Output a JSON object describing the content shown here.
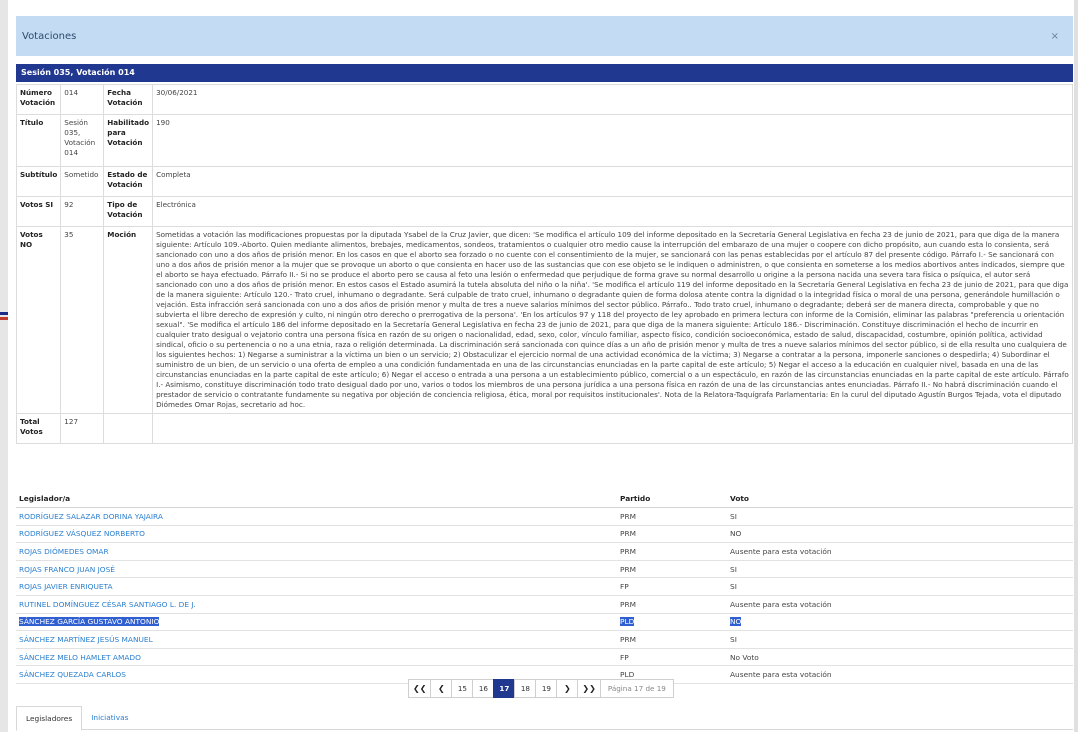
{
  "modal": {
    "title": "Votaciones",
    "close": "×"
  },
  "session_title": "Sesión 035, Votación 014",
  "details": {
    "numero_label": "Número Votación",
    "numero": "014",
    "fecha_label": "Fecha Votación",
    "fecha": "30/06/2021",
    "titulo_label": "Título",
    "titulo": "Sesión 035, Votación 014",
    "habilitado_label": "Habilitado para Votación",
    "habilitado": "190",
    "subtitulo_label": "Subtítulo",
    "subtitulo": "Sometido",
    "estado_label": "Estado de Votación",
    "estado": "Completa",
    "votos_si_label": "Votos SI",
    "votos_si": "92",
    "tipo_label": "Tipo de Votación",
    "tipo": "Electrónica",
    "votos_no_label": "Votos NO",
    "votos_no": "35",
    "mocion_label": "Moción",
    "mocion": "Sometidas a votación las modificaciones propuestas por la diputada Ysabel de la Cruz Javier, que dicen: 'Se modifica el artículo 109 del informe depositado en la Secretaría General Legislativa en fecha 23 de junio de 2021, para que diga de la manera siguiente: Artículo 109.-Aborto. Quien mediante alimentos, brebajes, medicamentos, sondeos, tratamientos o cualquier otro medio cause la interrupción del embarazo de una mujer o coopere con dicho propósito, aun cuando esta lo consienta, será sancionado con uno a dos años de prisión menor. En los casos en que el aborto sea forzado o no cuente con el consentimiento de la mujer, se sancionará con las penas establecidas por el artículo 87 del presente código. Párrafo I.- Se sancionará con uno a dos años de prisión menor a la mujer que se provoque un aborto o que consienta en hacer uso de las sustancias que con ese objeto se le indiquen o administren, o que consienta en someterse a los medios abortivos antes indicados, siempre que el aborto se haya efectuado. Párrafo II.- Si no se produce el aborto pero se causa al feto una lesión o enfermedad que perjudique de forma grave su normal desarrollo u origine a la persona nacida una severa tara física o psíquica, el autor será sancionado con uno a dos años de prisión menor. En estos casos el Estado asumirá la tutela absoluta del niño o la niña'. 'Se modifica el artículo 119 del informe depositado en la Secretaría General Legislativa en fecha 23 de junio de 2021, para que diga de la manera siguiente: Artículo 120.- Trato cruel, inhumano o degradante. Será culpable de trato cruel, inhumano o degradante quien de forma dolosa atente contra la dignidad o la integridad física o moral de una persona, generándole humillación o vejación. Esta infracción será sancionada con uno a dos años de prisión menor y multa de tres a nueve salarios mínimos del sector público. Párrafo.. Todo trato cruel, inhumano o degradante; deberá ser de manera directa, comprobable y que no subvierta el libre derecho de expresión y culto, ni ningún otro derecho o prerrogativa de la persona'. 'En los artículos 97 y 118 del proyecto de ley aprobado en primera lectura con informe de la Comisión, eliminar las palabras \"preferencia u orientación sexual\". 'Se modifica el artículo 186 del informe depositado en la Secretaría General Legislativa en fecha 23 de junio de 2021, para que diga de la manera siguiente: Artículo 186.- Discriminación. Constituye discriminación el hecho de incurrir en cualquier trato desigual o vejatorio contra una persona física en razón de su origen o nacionalidad, edad, sexo, color, vínculo familiar, aspecto físico, condición socioeconómica, estado de salud, discapacidad, costumbre, opinión política, actividad sindical, oficio o su pertenencia o no a una etnia, raza o religión determinada. La discriminación será sancionada con quince días a un año de prisión menor y multa de tres a nueve salarios mínimos del sector público, si de ella resulta uno cualquiera de los siguientes hechos: 1) Negarse a suministrar a la víctima un bien o un servicio; 2) Obstaculizar el ejercicio normal de una actividad económica de la víctima; 3) Negarse a contratar a la persona, imponerle sanciones o despedirla; 4) Subordinar el suministro de un bien, de un servicio o una oferta de empleo a una condición fundamentada en una de las circunstancias enunciadas en la parte capital de este artículo; 5) Negar el acceso a la educación en cualquier nivel, basada en una de las circunstancias enunciadas en la parte capital de este artículo; 6) Negar el acceso o entrada a una persona a un establecimiento público, comercial o a un espectáculo, en razón de las circunstancias enunciadas en la parte capital de este artículo. Párrafo I.- Asimismo, constituye discriminación todo trato desigual dado por uno, varios o todos los miembros de una persona jurídica a una persona física en razón de una de las circunstancias antes enunciadas. Párrafo II.- No habrá discriminación cuando el prestador de servicio o contratante fundamente su negativa por objeción de conciencia religiosa, ética, moral por requisitos institucionales'. Nota de la Relatora-Taquígrafa Parlamentaria: En la curul del diputado Agustín Burgos Tejada, vota el diputado Diómedes Omar Rojas, secretario ad hoc.",
    "total_label": "Total Votos",
    "total": "127"
  },
  "list": {
    "headers": {
      "legislador": "Legislador/a",
      "partido": "Partido",
      "voto": "Voto"
    },
    "rows": [
      {
        "name": "RODRÍGUEZ SALAZAR DORINA YAJAIRA",
        "party": "PRM",
        "vote": "SI"
      },
      {
        "name": "RODRÍGUEZ VÁSQUEZ NORBERTO",
        "party": "PRM",
        "vote": "NO"
      },
      {
        "name": "ROJAS DIÓMEDES OMAR",
        "party": "PRM",
        "vote": "Ausente para esta votación"
      },
      {
        "name": "ROJAS FRANCO JUAN JOSÉ",
        "party": "PRM",
        "vote": "SI"
      },
      {
        "name": "ROJAS JAVIER ENRIQUETA",
        "party": "FP",
        "vote": "SI"
      },
      {
        "name": "RUTINEL DOMÍNGUEZ CÉSAR SANTIAGO L. DE J.",
        "party": "PRM",
        "vote": "Ausente para esta votación"
      },
      {
        "name": "SÁNCHEZ GARCÍA GUSTAVO ANTONIO",
        "party": "PLD",
        "vote": "NO"
      },
      {
        "name": "SÁNCHEZ MARTÍNEZ JESÚS MANUEL",
        "party": "PRM",
        "vote": "SI"
      },
      {
        "name": "SÁNCHEZ MELO HAMLET AMADO",
        "party": "FP",
        "vote": "No Voto"
      },
      {
        "name": "SÁNCHEZ QUEZADA CARLOS",
        "party": "PLD",
        "vote": "Ausente para esta votación"
      }
    ],
    "selected_row": 6
  },
  "pagination": {
    "first": "❮❮",
    "prev": "❮",
    "pages": [
      "15",
      "16",
      "17",
      "18",
      "19"
    ],
    "current": "17",
    "next": "❯",
    "last": "❯❯",
    "info": "Página 17 de 19"
  },
  "tabs": {
    "legisladores": "Legisladores",
    "iniciativas": "Iniciativas"
  },
  "colors": {
    "header_bg": "#c3dcf4",
    "bar_bg": "#20388f",
    "link": "#2a7fcf",
    "selection": "#2f5fd0"
  }
}
